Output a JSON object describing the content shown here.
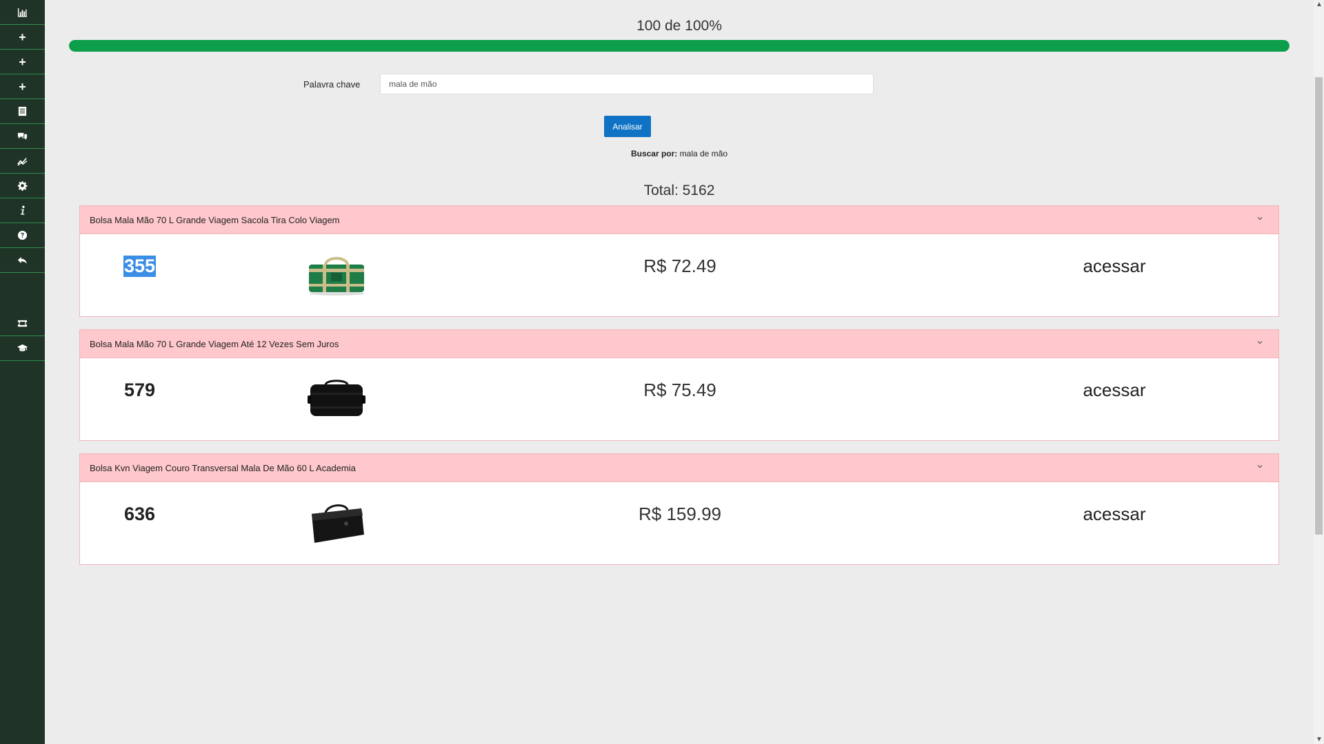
{
  "sidebar": {
    "items": [
      {
        "icon": "bar-chart-icon"
      },
      {
        "icon": "plus-icon",
        "label": "+"
      },
      {
        "icon": "plus-icon",
        "label": "+"
      },
      {
        "icon": "plus-icon",
        "label": "+"
      },
      {
        "icon": "document-icon"
      },
      {
        "icon": "comments-icon"
      },
      {
        "icon": "line-chart-icon"
      },
      {
        "icon": "gear-icon"
      },
      {
        "icon": "info-icon"
      },
      {
        "icon": "question-icon"
      },
      {
        "icon": "reply-icon"
      },
      {
        "icon": "ticket-icon"
      },
      {
        "icon": "graduation-cap-icon"
      }
    ]
  },
  "progress": {
    "label": "100 de 100%",
    "value": 100,
    "color": "#0c9e4a"
  },
  "keyword": {
    "label": "Palavra chave",
    "value": "mala de mão"
  },
  "analyze_button": "Analisar",
  "search_for": {
    "label": "Buscar por:",
    "value": "mala de mão"
  },
  "total": "Total: 5162",
  "products": [
    {
      "title": "Bolsa Mala Mão 70 L Grande Viagem Sacola Tira Colo Viagem",
      "rank": "355",
      "price": "R$ 72.49",
      "link": "acessar",
      "image": "green-travel-bag"
    },
    {
      "title": "Bolsa Mala Mão 70 L Grande Viagem Até 12 Vezes Sem Juros",
      "rank": "579",
      "price": "R$ 75.49",
      "link": "acessar",
      "image": "black-duffel-bag"
    },
    {
      "title": "Bolsa Kvn Viagem Couro Transversal Mala De Mão 60 L Academia",
      "rank": "636",
      "price": "R$ 159.99",
      "link": "acessar",
      "image": "black-leather-bag"
    }
  ]
}
